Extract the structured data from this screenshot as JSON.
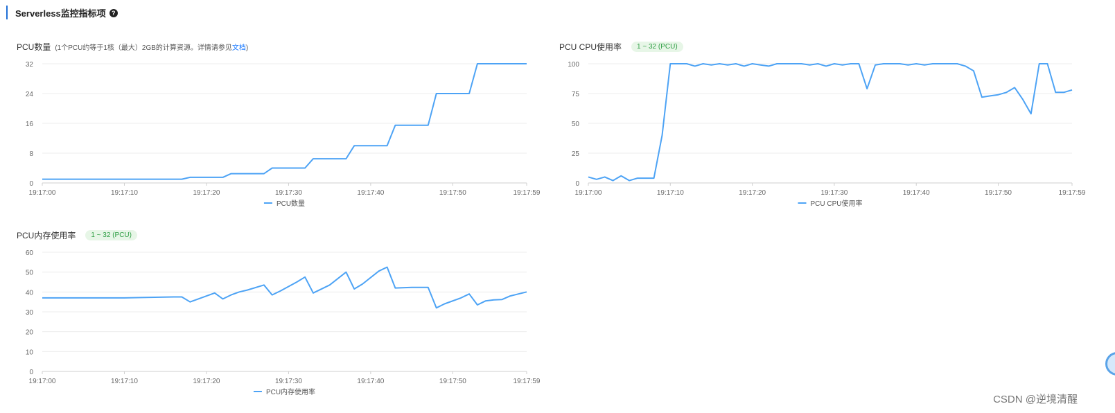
{
  "section": {
    "title": "Serverless监控指标项",
    "help_icon": "?"
  },
  "colors": {
    "accent": "#1f6fd6",
    "series": "#4da3f5",
    "badge_bg": "#e7f6e7",
    "badge_text": "#2f9e44",
    "grid": "#ececec"
  },
  "chart_data": [
    {
      "type": "line",
      "title": "PCU数量",
      "note": "(1个PCU约等于1核（最大）2GB的计算资源。详情请参见",
      "note_link": "文档",
      "note_end": ")",
      "badge": "",
      "ylim": [
        0,
        32
      ],
      "yticks": [
        "0",
        "8",
        "16",
        "24",
        "32"
      ],
      "xlim": [
        0,
        59
      ],
      "xticks": [
        {
          "t": 0,
          "label": "19:17:00"
        },
        {
          "t": 10,
          "label": "19:17:10"
        },
        {
          "t": 20,
          "label": "19:17:20"
        },
        {
          "t": 30,
          "label": "19:17:30"
        },
        {
          "t": 40,
          "label": "19:17:40"
        },
        {
          "t": 50,
          "label": "19:17:50"
        },
        {
          "t": 59,
          "label": "19:17:59"
        }
      ],
      "grid": true,
      "legend": "bottom",
      "series": [
        {
          "name": "PCU数量",
          "x": [
            0,
            17,
            18,
            22,
            23,
            27,
            28,
            32,
            33,
            37,
            38,
            42,
            43,
            47,
            48,
            52,
            53,
            59
          ],
          "y": [
            1,
            1,
            1.5,
            1.5,
            2.5,
            2.5,
            4,
            4,
            6.5,
            6.5,
            10,
            10,
            15.5,
            15.5,
            24,
            24,
            32,
            32
          ]
        }
      ]
    },
    {
      "type": "line",
      "title": "PCU CPU使用率",
      "note": "",
      "note_link": "",
      "note_end": "",
      "badge": "1 ~ 32 (PCU)",
      "ylim": [
        0,
        100
      ],
      "yticks": [
        "0",
        "25",
        "50",
        "75",
        "100"
      ],
      "xlim": [
        0,
        59
      ],
      "xticks": [
        {
          "t": 0,
          "label": "19:17:00"
        },
        {
          "t": 10,
          "label": "19:17:10"
        },
        {
          "t": 20,
          "label": "19:17:20"
        },
        {
          "t": 30,
          "label": "19:17:30"
        },
        {
          "t": 40,
          "label": "19:17:40"
        },
        {
          "t": 50,
          "label": "19:17:50"
        },
        {
          "t": 59,
          "label": "19:17:59"
        }
      ],
      "grid": true,
      "legend": "bottom",
      "series": [
        {
          "name": "PCU CPU使用率",
          "x": [
            0,
            1,
            2,
            3,
            4,
            5,
            6,
            7,
            8,
            9,
            10,
            11,
            12,
            13,
            14,
            15,
            16,
            17,
            18,
            19,
            20,
            21,
            22,
            23,
            24,
            25,
            26,
            27,
            28,
            29,
            30,
            31,
            32,
            33,
            34,
            35,
            36,
            37,
            38,
            39,
            40,
            41,
            42,
            43,
            44,
            45,
            46,
            47,
            48,
            49,
            50,
            51,
            52,
            53,
            54,
            55,
            56,
            57,
            58,
            59
          ],
          "y": [
            5,
            3,
            5,
            2,
            6,
            2,
            4,
            4,
            4,
            40,
            100,
            100,
            100,
            98,
            100,
            99,
            100,
            99,
            100,
            98,
            100,
            99,
            98,
            100,
            100,
            100,
            100,
            99,
            100,
            98,
            100,
            99,
            100,
            100,
            79,
            99,
            100,
            100,
            100,
            99,
            100,
            99,
            100,
            100,
            100,
            100,
            98,
            94,
            72,
            73,
            74,
            76,
            80,
            70,
            58,
            100,
            100,
            76,
            76,
            78
          ]
        }
      ]
    },
    {
      "type": "line",
      "title": "PCU内存使用率",
      "note": "",
      "note_link": "",
      "note_end": "",
      "badge": "1 ~ 32 (PCU)",
      "ylim": [
        0,
        60
      ],
      "yticks": [
        "0",
        "10",
        "20",
        "30",
        "40",
        "50",
        "60"
      ],
      "xlim": [
        0,
        59
      ],
      "xticks": [
        {
          "t": 0,
          "label": "19:17:00"
        },
        {
          "t": 10,
          "label": "19:17:10"
        },
        {
          "t": 20,
          "label": "19:17:20"
        },
        {
          "t": 30,
          "label": "19:17:30"
        },
        {
          "t": 40,
          "label": "19:17:40"
        },
        {
          "t": 50,
          "label": "19:17:50"
        },
        {
          "t": 59,
          "label": "19:17:59"
        }
      ],
      "grid": true,
      "legend": "bottom",
      "series": [
        {
          "name": "PCU内存使用率",
          "x": [
            0,
            10,
            12,
            16,
            17,
            18,
            19,
            21,
            22,
            23,
            24,
            25,
            27,
            28,
            29,
            31,
            32,
            33,
            35,
            37,
            38,
            39,
            41,
            42,
            43,
            45,
            47,
            48,
            49,
            51,
            52,
            53,
            54,
            55,
            56,
            57,
            58,
            59
          ],
          "y": [
            37,
            37,
            37.2,
            37.5,
            37.5,
            35,
            36.5,
            39.5,
            36.5,
            38.5,
            40,
            41,
            43.5,
            38.5,
            40.5,
            45,
            47.5,
            39.5,
            43.5,
            50,
            41.5,
            44,
            50.5,
            52.5,
            42,
            42.3,
            42.3,
            32,
            34,
            37,
            39,
            33.5,
            35.5,
            36,
            36.2,
            38,
            39,
            40
          ]
        }
      ]
    }
  ],
  "watermark": "CSDN @逆境清醒"
}
